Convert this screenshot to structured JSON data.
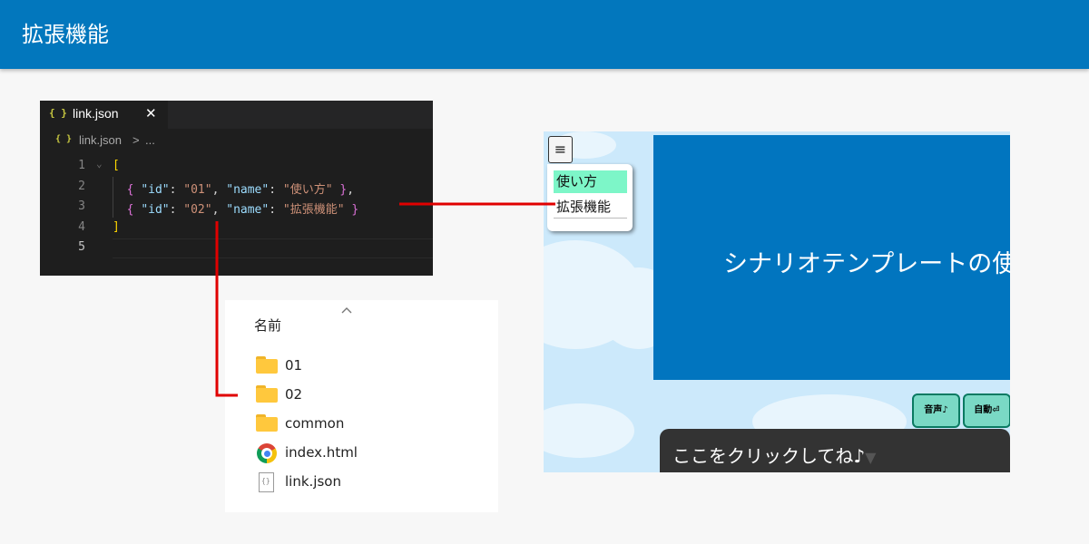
{
  "header": {
    "title": "拡張機能"
  },
  "editor": {
    "tab": {
      "icon_text": "{ }",
      "label": "link.json",
      "close": "✕"
    },
    "breadcrumb": {
      "icon_text": "{ }",
      "file": "link.json",
      "sep": ">",
      "more": "..."
    },
    "lines": [
      {
        "num": "1",
        "code": "["
      },
      {
        "num": "2",
        "code": "  { \"id\": \"01\", \"name\": \"使い方\" },"
      },
      {
        "num": "3",
        "code": "  { \"id\": \"02\", \"name\": \"拡張機能\" }"
      },
      {
        "num": "4",
        "code": "]"
      },
      {
        "num": "5",
        "code": ""
      }
    ]
  },
  "explorer": {
    "column_header": "名前",
    "items": [
      {
        "name": "01",
        "type": "folder"
      },
      {
        "name": "02",
        "type": "folder"
      },
      {
        "name": "common",
        "type": "folder"
      },
      {
        "name": "index.html",
        "type": "chrome-html"
      },
      {
        "name": "link.json",
        "type": "json-file"
      }
    ]
  },
  "game": {
    "menu_button": "≡",
    "menu_items": [
      "使い方",
      "拡張機能"
    ],
    "screen_title": "シナリオテンプレートの使",
    "controls": [
      "音声♪",
      "自動⏎"
    ],
    "dialog_text": "ここをクリックしてね♪",
    "dialog_caret": "▼"
  },
  "colors": {
    "header_bg": "#0277bd",
    "connector": "#e00000",
    "screen_bg": "#0175bf",
    "menu_selected": "#7df6c8",
    "control_bg": "#7ad9c5"
  }
}
